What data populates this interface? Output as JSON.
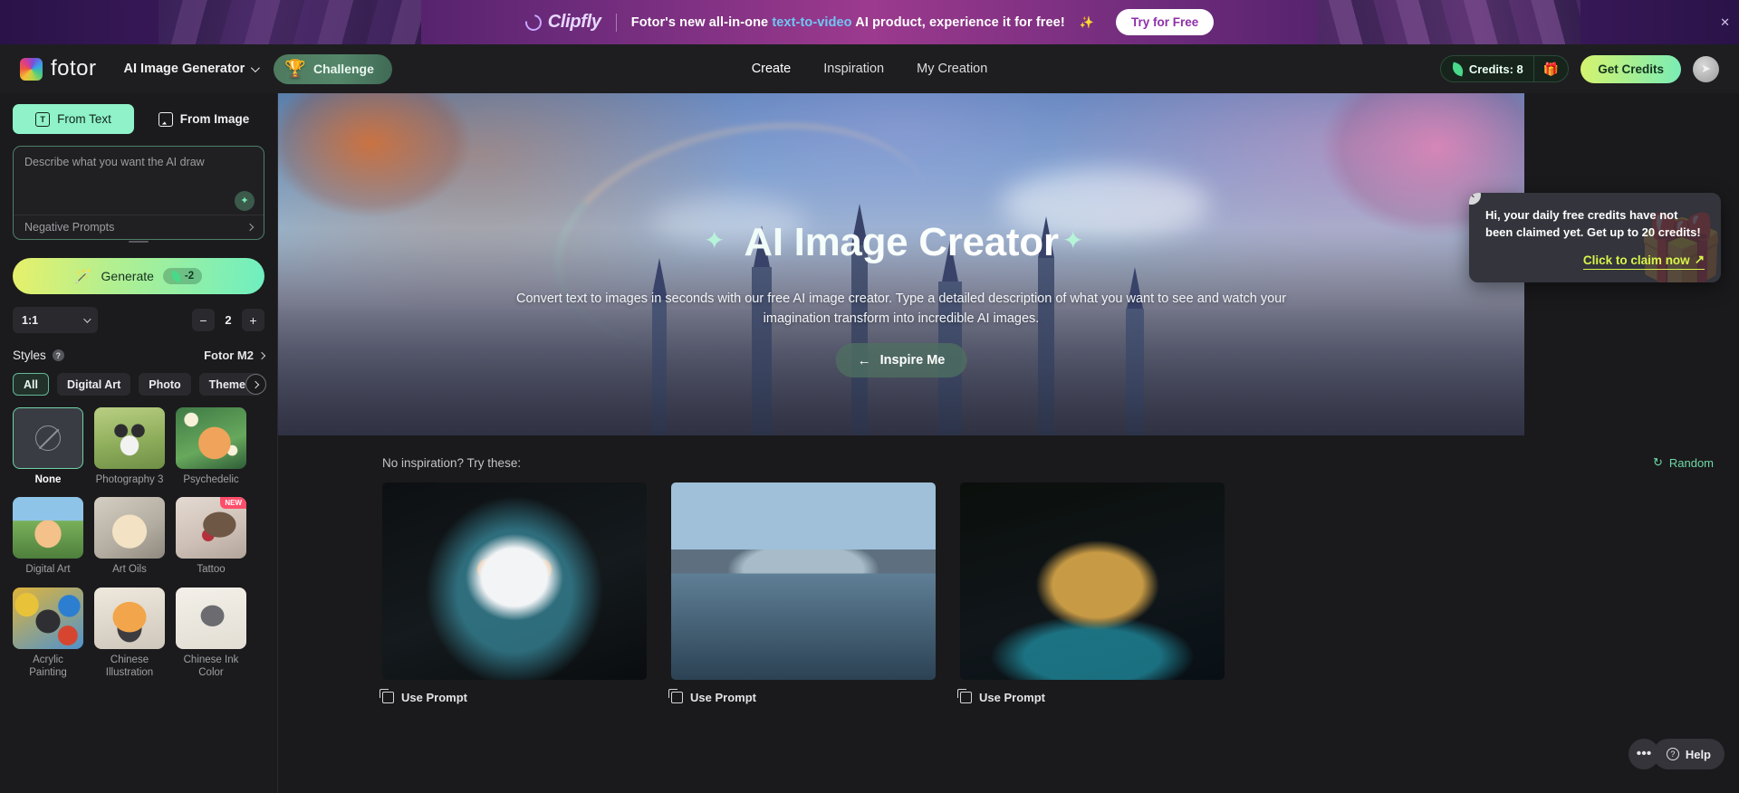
{
  "promo": {
    "brand": "Clipfly",
    "text_before": "Fotor's new all-in-one ",
    "text_highlight": "text-to-video",
    "text_after": " AI product, experience it for free!",
    "sparkle": "✨",
    "cta": "Try for Free",
    "close": "✕"
  },
  "topnav": {
    "brand_name": "fotor",
    "product": "AI Image Generator",
    "challenge": "Challenge",
    "trophy": "🏆",
    "links": [
      {
        "label": "Create",
        "active": true
      },
      {
        "label": "Inspiration",
        "active": false
      },
      {
        "label": "My Creation",
        "active": false
      }
    ],
    "credits_label": "Credits: 8",
    "gift": "🎁",
    "get_credits": "Get Credits",
    "avatar_glyph": "➤"
  },
  "left_panel": {
    "tabs": [
      {
        "label": "From Text",
        "active": true
      },
      {
        "label": "From Image",
        "active": false
      }
    ],
    "tab_text_glyph": "T",
    "prompt_placeholder": "Describe what you want the AI draw",
    "prompt_value": "",
    "magic_glyph": "✦",
    "negative_prompts": "Negative Prompts",
    "generate_label": "Generate",
    "generate_cost": "-2",
    "wand": "🪄",
    "aspect_ratio": "1:1",
    "count": "2",
    "minus": "−",
    "plus": "+",
    "styles_title": "Styles",
    "help_glyph": "?",
    "model": "Fotor M2",
    "filters": [
      {
        "label": "All",
        "active": true
      },
      {
        "label": "Digital Art",
        "active": false
      },
      {
        "label": "Photo",
        "active": false
      },
      {
        "label": "Themes",
        "active": false
      }
    ],
    "styles": [
      {
        "label": "None",
        "selected": true,
        "thumb": "none",
        "badge": ""
      },
      {
        "label": "Photography 3",
        "selected": false,
        "thumb": "t-photo3",
        "badge": ""
      },
      {
        "label": "Psychedelic",
        "selected": false,
        "thumb": "t-psy",
        "badge": ""
      },
      {
        "label": "Digital Art",
        "selected": false,
        "thumb": "t-digital",
        "badge": ""
      },
      {
        "label": "Art Oils",
        "selected": false,
        "thumb": "t-oils",
        "badge": ""
      },
      {
        "label": "Tattoo",
        "selected": false,
        "thumb": "t-tattoo",
        "badge": "NEW"
      },
      {
        "label": "Acrylic Painting",
        "selected": false,
        "thumb": "t-acrylic",
        "badge": ""
      },
      {
        "label": "Chinese Illustration",
        "selected": false,
        "thumb": "t-chinese",
        "badge": ""
      },
      {
        "label": "Chinese Ink Color",
        "selected": false,
        "thumb": "t-ink",
        "badge": ""
      }
    ]
  },
  "hero": {
    "title": "AI Image Creator",
    "sparkle_left": "✦",
    "sparkle_right": "✦",
    "description": "Convert text to images in seconds with our free AI image creator. Type a detailed description of what you want to see and watch your imagination transform into incredible AI images.",
    "inspire_label": "Inspire Me",
    "inspire_arrow": "←",
    "next_arrow": "›"
  },
  "inspiration": {
    "heading": "No inspiration? Try these:",
    "random_label": "Random",
    "random_icon": "↻",
    "cards": [
      {
        "use_prompt": "Use Prompt",
        "art": "c1"
      },
      {
        "use_prompt": "Use Prompt",
        "art": "c2"
      },
      {
        "use_prompt": "Use Prompt",
        "art": "c3"
      }
    ]
  },
  "toast": {
    "message": "Hi, your daily free credits have not been claimed yet. Get up to 20 credits!",
    "cta": "Click to claim now",
    "cta_arrow": "↗",
    "close": "✕",
    "gift": "🎁"
  },
  "footer": {
    "dots": "•••",
    "help_label": "Help",
    "help_glyph": "?"
  },
  "colors": {
    "accent_mint": "#8ff2c9",
    "accent_green": "#6fd8a6",
    "cta_yellow": "#d7f549",
    "panel_bg": "#1b1b1d",
    "nav_bg": "#1e1e20"
  }
}
